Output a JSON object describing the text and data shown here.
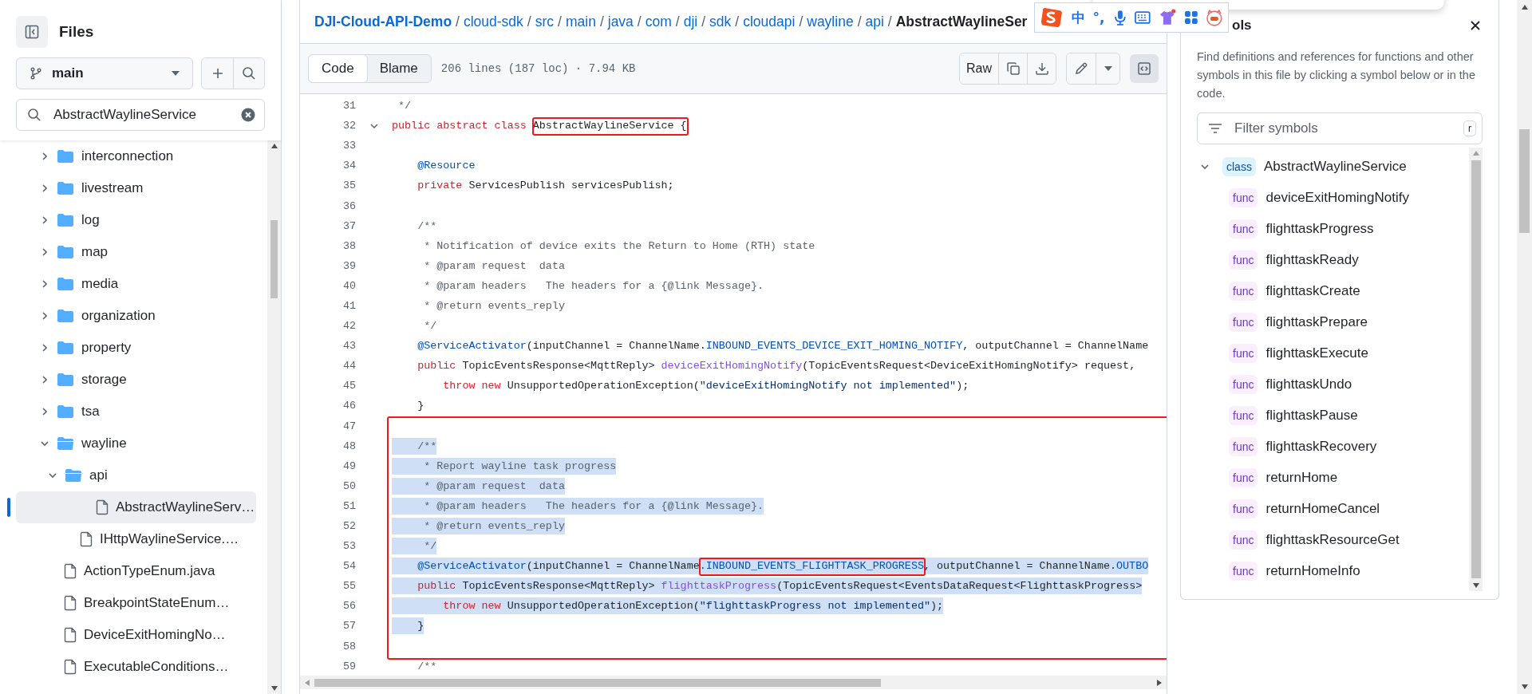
{
  "sidebar": {
    "title": "Files",
    "branch": "main",
    "search": {
      "value": "AbstractWaylineService"
    },
    "tree": [
      {
        "label": "interconnection",
        "kind": "folder",
        "expanded": false,
        "selected": false
      },
      {
        "label": "livestream",
        "kind": "folder",
        "expanded": false,
        "selected": false
      },
      {
        "label": "log",
        "kind": "folder",
        "expanded": false,
        "selected": false
      },
      {
        "label": "map",
        "kind": "folder",
        "expanded": false,
        "selected": false
      },
      {
        "label": "media",
        "kind": "folder",
        "expanded": false,
        "selected": false
      },
      {
        "label": "organization",
        "kind": "folder",
        "expanded": false,
        "selected": false
      },
      {
        "label": "property",
        "kind": "folder",
        "expanded": false,
        "selected": false
      },
      {
        "label": "storage",
        "kind": "folder",
        "expanded": false,
        "selected": false
      },
      {
        "label": "tsa",
        "kind": "folder",
        "expanded": false,
        "selected": false
      },
      {
        "label": "wayline",
        "kind": "folder",
        "expanded": true,
        "selected": false,
        "children": [
          {
            "label": "api",
            "kind": "folder",
            "expanded": true,
            "selected": false,
            "children": [
              {
                "label": "AbstractWaylineServ…",
                "kind": "file",
                "selected": true
              },
              {
                "label": "IHttpWaylineService.…",
                "kind": "file",
                "selected": false
              }
            ]
          },
          {
            "label": "ActionTypeEnum.java",
            "kind": "file",
            "selected": false
          },
          {
            "label": "BreakpointStateEnum…",
            "kind": "file",
            "selected": false
          },
          {
            "label": "DeviceExitHomingNo…",
            "kind": "file",
            "selected": false
          },
          {
            "label": "ExecutableConditions…",
            "kind": "file",
            "selected": false
          }
        ]
      }
    ]
  },
  "breadcrumb": [
    {
      "text": "DJI-Cloud-API-Demo",
      "separator": "/"
    },
    {
      "text": "cloud-sdk",
      "separator": "/"
    },
    {
      "text": "src",
      "separator": "/"
    },
    {
      "text": "main",
      "separator": "/"
    },
    {
      "text": "java",
      "separator": "/"
    },
    {
      "text": "com",
      "separator": "/"
    },
    {
      "text": "dji",
      "separator": "/"
    },
    {
      "text": "sdk",
      "separator": "/"
    },
    {
      "text": "cloudapi",
      "separator": "/"
    },
    {
      "text": "wayline",
      "separator": "/"
    },
    {
      "text": "api",
      "separator": "/"
    },
    {
      "text": "AbstractWaylineSer"
    }
  ],
  "ime_toolbar": {
    "labels": [
      "中",
      "°,"
    ]
  },
  "toolbar": {
    "tabs": [
      {
        "label": "Code",
        "selected": true
      },
      {
        "label": "Blame",
        "selected": false
      }
    ],
    "file_info": "206 lines (187 loc) · 7.94 KB",
    "raw": "Raw",
    "symbols_toggle": {
      "selected": true
    }
  },
  "code": {
    "lines": [
      {
        "number": "31",
        "selected": false,
        "tokens": [
          {
            "kind": "comment",
            "text": " */"
          }
        ]
      },
      {
        "number": "32",
        "selected": false,
        "fold": {
          "expanded": true
        },
        "tokens": [
          {
            "kind": "keyword",
            "text": "public abstract class "
          },
          {
            "kind": "plain",
            "text": "AbstractWaylineService {",
            "boxed": true
          }
        ]
      },
      {
        "number": "33",
        "selected": false
      },
      {
        "number": "34",
        "selected": false,
        "tokens": [
          {
            "kind": "annotation",
            "text": "    @Resource"
          }
        ]
      },
      {
        "number": "35",
        "selected": false,
        "tokens": [
          {
            "kind": "keyword",
            "text": "    private"
          },
          {
            "kind": "plain",
            "text": " ServicesPublish servicesPublish;"
          }
        ]
      },
      {
        "number": "36",
        "selected": false
      },
      {
        "number": "37",
        "selected": false,
        "tokens": [
          {
            "kind": "comment",
            "text": "    /**"
          }
        ]
      },
      {
        "number": "38",
        "selected": false,
        "tokens": [
          {
            "kind": "comment",
            "text": "     * Notification of device exits the Return to Home (RTH) state"
          }
        ]
      },
      {
        "number": "39",
        "selected": false,
        "tokens": [
          {
            "kind": "comment",
            "text": "     * @param request  data"
          }
        ]
      },
      {
        "number": "40",
        "selected": false,
        "tokens": [
          {
            "kind": "comment",
            "text": "     * @param headers   The headers for a {@link Message}."
          }
        ]
      },
      {
        "number": "41",
        "selected": false,
        "tokens": [
          {
            "kind": "comment",
            "text": "     * @return events_reply"
          }
        ]
      },
      {
        "number": "42",
        "selected": false,
        "tokens": [
          {
            "kind": "comment",
            "text": "     */"
          }
        ]
      },
      {
        "number": "43",
        "selected": false,
        "tokens": [
          {
            "kind": "annotation",
            "text": "    @ServiceActivator"
          },
          {
            "kind": "plain",
            "text": "(inputChannel = ChannelName."
          },
          {
            "kind": "constant",
            "text": "INBOUND_EVENTS_DEVICE_EXIT_HOMING_NOTIFY"
          },
          {
            "kind": "plain",
            "text": ", outputChannel = ChannelName"
          }
        ]
      },
      {
        "number": "44",
        "selected": false,
        "tokens": [
          {
            "kind": "keyword",
            "text": "    public"
          },
          {
            "kind": "plain",
            "text": " TopicEventsResponse<MqttReply> "
          },
          {
            "kind": "function",
            "text": "deviceExitHomingNotify"
          },
          {
            "kind": "plain",
            "text": "(TopicEventsRequest<DeviceExitHomingNotify> request,"
          }
        ]
      },
      {
        "number": "45",
        "selected": false,
        "tokens": [
          {
            "kind": "keyword",
            "text": "        throw new"
          },
          {
            "kind": "plain",
            "text": " UnsupportedOperationException("
          },
          {
            "kind": "string",
            "text": "\"deviceExitHomingNotify not implemented\""
          },
          {
            "kind": "plain",
            "text": ");"
          }
        ]
      },
      {
        "number": "46",
        "selected": false,
        "tokens": [
          {
            "kind": "plain",
            "text": "    }"
          }
        ]
      },
      {
        "number": "47",
        "selected": false,
        "boxed": true
      },
      {
        "number": "48",
        "selected": true,
        "boxed": true,
        "tokens": [
          {
            "kind": "comment",
            "text": "    /**"
          }
        ]
      },
      {
        "number": "49",
        "selected": true,
        "boxed": true,
        "tokens": [
          {
            "kind": "comment",
            "text": "     * Report wayline task progress"
          }
        ]
      },
      {
        "number": "50",
        "selected": true,
        "boxed": true,
        "tokens": [
          {
            "kind": "comment",
            "text": "     * @param request  data"
          }
        ]
      },
      {
        "number": "51",
        "selected": true,
        "boxed": true,
        "tokens": [
          {
            "kind": "comment",
            "text": "     * @param headers   The headers for a {@link Message}."
          }
        ]
      },
      {
        "number": "52",
        "selected": true,
        "boxed": true,
        "tokens": [
          {
            "kind": "comment",
            "text": "     * @return events_reply"
          }
        ]
      },
      {
        "number": "53",
        "selected": true,
        "boxed": true,
        "tokens": [
          {
            "kind": "comment",
            "text": "     */"
          }
        ]
      },
      {
        "number": "54",
        "selected": true,
        "boxed": true,
        "tokens": [
          {
            "kind": "annotation",
            "text": "    @ServiceActivator"
          },
          {
            "kind": "plain",
            "text": "(inputChannel = ChannelName"
          },
          {
            "kind": "constant",
            "text": ".INBOUND_EVENTS_FLIGHTTASK_PROGRESS",
            "boxed": true
          },
          {
            "kind": "plain",
            "text": ", outputChannel = ChannelName."
          },
          {
            "kind": "constant",
            "text": "OUTBO"
          }
        ]
      },
      {
        "number": "55",
        "selected": true,
        "boxed": true,
        "tokens": [
          {
            "kind": "keyword",
            "text": "    public"
          },
          {
            "kind": "plain",
            "text": " TopicEventsResponse<MqttReply> "
          },
          {
            "kind": "function",
            "text": "flighttaskProgress"
          },
          {
            "kind": "plain",
            "text": "(TopicEventsRequest<EventsDataRequest<FlighttaskProgress>"
          }
        ]
      },
      {
        "number": "56",
        "selected": true,
        "boxed": true,
        "tokens": [
          {
            "kind": "keyword",
            "text": "        throw new"
          },
          {
            "kind": "plain",
            "text": " UnsupportedOperationException("
          },
          {
            "kind": "string",
            "text": "\"flighttaskProgress not implemented\""
          },
          {
            "kind": "plain",
            "text": ");"
          }
        ]
      },
      {
        "number": "57",
        "selected": true,
        "boxed": true,
        "tokens": [
          {
            "kind": "plain",
            "text": "    }"
          }
        ]
      },
      {
        "number": "58",
        "selected": false,
        "boxed": true
      },
      {
        "number": "59",
        "selected": false,
        "tokens": [
          {
            "kind": "comment",
            "text": "    /**"
          }
        ]
      }
    ]
  },
  "symbols": {
    "title": "ols",
    "description": "Find definitions and references for functions and other symbols in this file by clicking a symbol below or in the code.",
    "filter": {
      "placeholder": "Filter symbols",
      "shortcut": "r"
    },
    "items": [
      {
        "tag": "class",
        "label": "AbstractWaylineService",
        "kind": "class",
        "expanded": true,
        "children": [
          {
            "tag": "func",
            "label": "deviceExitHomingNotify",
            "kind": "func"
          },
          {
            "tag": "func",
            "label": "flighttaskProgress",
            "kind": "func"
          },
          {
            "tag": "func",
            "label": "flighttaskReady",
            "kind": "func"
          },
          {
            "tag": "func",
            "label": "flighttaskCreate",
            "kind": "func"
          },
          {
            "tag": "func",
            "label": "flighttaskPrepare",
            "kind": "func"
          },
          {
            "tag": "func",
            "label": "flighttaskExecute",
            "kind": "func"
          },
          {
            "tag": "func",
            "label": "flighttaskUndo",
            "kind": "func"
          },
          {
            "tag": "func",
            "label": "flighttaskPause",
            "kind": "func"
          },
          {
            "tag": "func",
            "label": "flighttaskRecovery",
            "kind": "func"
          },
          {
            "tag": "func",
            "label": "returnHome",
            "kind": "func"
          },
          {
            "tag": "func",
            "label": "returnHomeCancel",
            "kind": "func"
          },
          {
            "tag": "func",
            "label": "flighttaskResourceGet",
            "kind": "func"
          },
          {
            "tag": "func",
            "label": "returnHomeInfo",
            "kind": "func"
          }
        ]
      }
    ]
  }
}
